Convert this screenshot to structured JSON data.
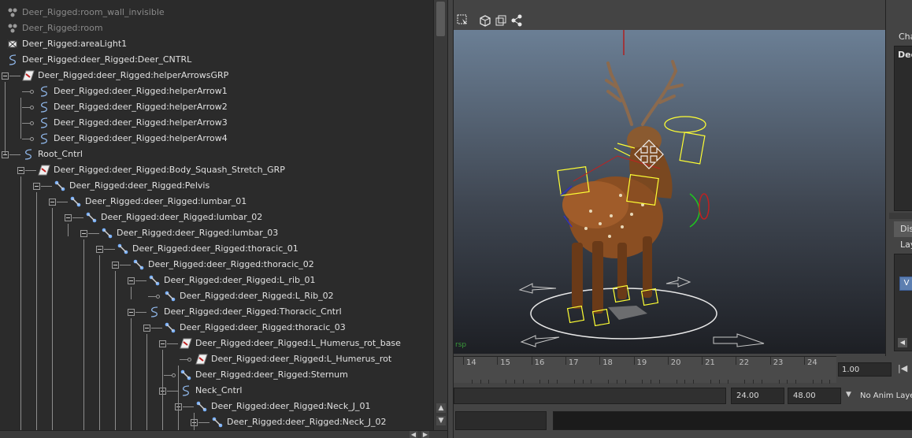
{
  "outliner": {
    "items": [
      {
        "label": "Deer_Rigged:room_wall_invisible",
        "icon": "group-icon",
        "dim": true
      },
      {
        "label": "Deer_Rigged:room",
        "icon": "group-icon",
        "dim": true
      },
      {
        "label": "Deer_Rigged:areaLight1",
        "icon": "area-light-icon",
        "dim": false
      },
      {
        "label": "Deer_Rigged:deer_Rigged:Deer_CNTRL",
        "icon": "curve-icon",
        "dim": false
      },
      {
        "label": "Deer_Rigged:deer_Rigged:helperArrowsGRP",
        "icon": "transform-icon",
        "dim": false
      },
      {
        "label": "Deer_Rigged:deer_Rigged:helperArrow1",
        "icon": "curve-icon",
        "dim": false
      },
      {
        "label": "Deer_Rigged:deer_Rigged:helperArrow2",
        "icon": "curve-icon",
        "dim": false
      },
      {
        "label": "Deer_Rigged:deer_Rigged:helperArrow3",
        "icon": "curve-icon",
        "dim": false
      },
      {
        "label": "Deer_Rigged:deer_Rigged:helperArrow4",
        "icon": "curve-icon",
        "dim": false
      },
      {
        "label": "Root_Cntrl",
        "icon": "curve-icon",
        "dim": false
      },
      {
        "label": "Deer_Rigged:deer_Rigged:Body_Squash_Stretch_GRP",
        "icon": "transform-icon",
        "dim": false
      },
      {
        "label": "Deer_Rigged:deer_Rigged:Pelvis",
        "icon": "joint-icon",
        "dim": false
      },
      {
        "label": "Deer_Rigged:deer_Rigged:lumbar_01",
        "icon": "joint-icon",
        "dim": false
      },
      {
        "label": "Deer_Rigged:deer_Rigged:lumbar_02",
        "icon": "joint-icon",
        "dim": false
      },
      {
        "label": "Deer_Rigged:deer_Rigged:lumbar_03",
        "icon": "joint-icon",
        "dim": false
      },
      {
        "label": "Deer_Rigged:deer_Rigged:thoracic_01",
        "icon": "joint-icon",
        "dim": false
      },
      {
        "label": "Deer_Rigged:deer_Rigged:thoracic_02",
        "icon": "joint-icon",
        "dim": false
      },
      {
        "label": "Deer_Rigged:deer_Rigged:L_rib_01",
        "icon": "joint-icon",
        "dim": false
      },
      {
        "label": "Deer_Rigged:deer_Rigged:L_Rib_02",
        "icon": "joint-icon",
        "dim": false
      },
      {
        "label": "Deer_Rigged:deer_Rigged:Thoracic_Cntrl",
        "icon": "curve-icon",
        "dim": false
      },
      {
        "label": "Deer_Rigged:deer_Rigged:thoracic_03",
        "icon": "joint-icon",
        "dim": false
      },
      {
        "label": "Deer_Rigged:deer_Rigged:L_Humerus_rot_base",
        "icon": "transform-icon",
        "dim": false
      },
      {
        "label": "Deer_Rigged:deer_Rigged:L_Humerus_rot",
        "icon": "transform-icon",
        "dim": false
      },
      {
        "label": "Deer_Rigged:deer_Rigged:Sternum",
        "icon": "joint-icon",
        "dim": false
      },
      {
        "label": "Neck_Cntrl",
        "icon": "curve-icon",
        "dim": false
      },
      {
        "label": "Deer_Rigged:deer_Rigged:Neck_J_01",
        "icon": "joint-icon",
        "dim": false
      },
      {
        "label": "Deer_Rigged:deer_Rigged:Neck_J_02",
        "icon": "joint-icon",
        "dim": false
      }
    ]
  },
  "viewport": {
    "camera_label": "rsp",
    "toolbar_icons": [
      "select-icon",
      "cube-icon",
      "camera-icon",
      "share-icon"
    ]
  },
  "timeline": {
    "ticks": [
      "14",
      "15",
      "16",
      "17",
      "18",
      "19",
      "20",
      "21",
      "22",
      "23",
      "24"
    ],
    "current_time": "1.00"
  },
  "range": {
    "end_time": "24.00",
    "anim_end": "48.00",
    "anim_layer": "No Anim Laye"
  },
  "channel_box": {
    "tab": "Cha",
    "object": "Dee",
    "display_tab": "Dis",
    "layers_label": "Lay",
    "visibility": "V"
  }
}
